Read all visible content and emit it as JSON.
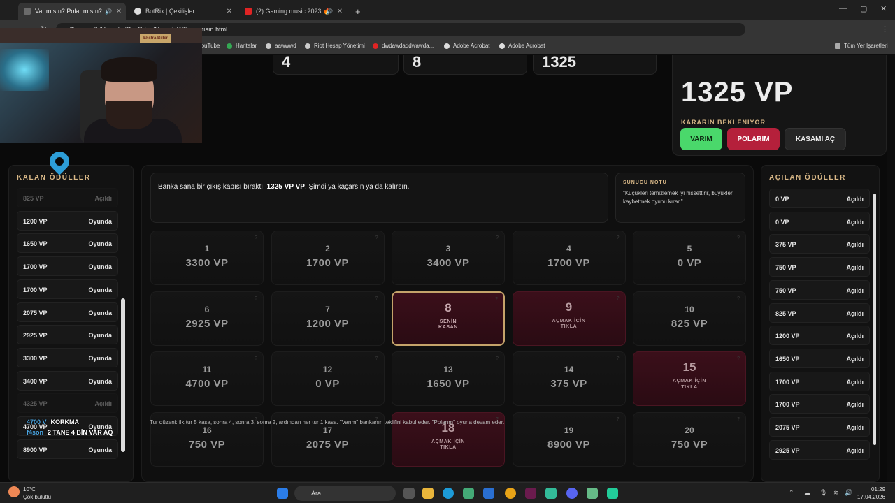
{
  "browser": {
    "tabs": [
      {
        "label": "Var mısın? Polar mısın?",
        "active": true
      },
      {
        "label": "BotRix | Çekilişler",
        "active": false
      },
      {
        "label": "(2) Gaming music 2023 🔥",
        "active": false
      }
    ],
    "new_tab": "+",
    "url_scheme": "Dosya",
    "url": "C:/Users/.../OneDrive/Masaüstü/Polarmısın.html",
    "bookmarks": [
      "YouTube",
      "Haritalar",
      "aawwwd",
      "Riot Hesap Yönetimi",
      "dwdawdaddwawda...",
      "Adobe Acrobat",
      "Adobe Acrobat"
    ],
    "all_bookmarks": "Tüm Yer İşaretleri"
  },
  "stats": [
    "4",
    "8",
    "1325"
  ],
  "offer": {
    "amount": "1325 VP",
    "status": "KARARIN BEKLENIYOR",
    "btn_varim": "VARIM",
    "btn_polarim": "POLARIM",
    "btn_kasa": "KASAMI AÇ"
  },
  "left_panel": {
    "title": "KALAN ÖDÜLLER",
    "rows": [
      {
        "value": "825 VP",
        "status": "Açıldı"
      },
      {
        "value": "1200 VP",
        "status": "Oyunda"
      },
      {
        "value": "1650 VP",
        "status": "Oyunda"
      },
      {
        "value": "1700 VP",
        "status": "Oyunda"
      },
      {
        "value": "1700 VP",
        "status": "Oyunda"
      },
      {
        "value": "2075 VP",
        "status": "Oyunda"
      },
      {
        "value": "2925 VP",
        "status": "Oyunda"
      },
      {
        "value": "3300 VP",
        "status": "Oyunda"
      },
      {
        "value": "3400 VP",
        "status": "Oyunda"
      },
      {
        "value": "4325 VP",
        "status": "Açıldı"
      },
      {
        "value": "4700 VP",
        "status": "Oyunda"
      },
      {
        "value": "8900 VP",
        "status": "Oyunda"
      }
    ]
  },
  "right_panel": {
    "title": "AÇILAN ÖDÜLLER",
    "rows": [
      {
        "value": "0 VP",
        "status": "Açıldı"
      },
      {
        "value": "0 VP",
        "status": "Açıldı"
      },
      {
        "value": "375 VP",
        "status": "Açıldı"
      },
      {
        "value": "750 VP",
        "status": "Açıldı"
      },
      {
        "value": "750 VP",
        "status": "Açıldı"
      },
      {
        "value": "825 VP",
        "status": "Açıldı"
      },
      {
        "value": "1200 VP",
        "status": "Açıldı"
      },
      {
        "value": "1650 VP",
        "status": "Açıldı"
      },
      {
        "value": "1700 VP",
        "status": "Açıldı"
      },
      {
        "value": "1700 VP",
        "status": "Açıldı"
      },
      {
        "value": "2075 VP",
        "status": "Açıldı"
      },
      {
        "value": "2925 VP",
        "status": "Açıldı"
      }
    ]
  },
  "message": {
    "prefix": "Banka sana bir çıkış kapısı bıraktı: ",
    "bold": "1325 VP VP",
    "suffix": ". Şimdi ya kaçarsın ya da kalırsın."
  },
  "host_note": {
    "title": "SUNUCU NOTU",
    "text": "\"Küçükleri temizlemek iyi hissettirir, büyükleri kaybetmek oyunu kırar.\""
  },
  "boxes": [
    {
      "n": "1",
      "p": "3300 VP",
      "state": "opened"
    },
    {
      "n": "2",
      "p": "1700 VP",
      "state": "opened"
    },
    {
      "n": "3",
      "p": "3400 VP",
      "state": "opened"
    },
    {
      "n": "4",
      "p": "1700 VP",
      "state": "opened"
    },
    {
      "n": "5",
      "p": "0 VP",
      "state": "opened"
    },
    {
      "n": "6",
      "p": "2925 VP",
      "state": "opened"
    },
    {
      "n": "7",
      "p": "1200 VP",
      "state": "opened"
    },
    {
      "n": "8",
      "p": "SENİN KASAN",
      "state": "mine"
    },
    {
      "n": "9",
      "p": "AÇMAK İÇİN TIKLA",
      "state": "closed"
    },
    {
      "n": "10",
      "p": "825 VP",
      "state": "opened"
    },
    {
      "n": "11",
      "p": "4700 VP",
      "state": "opened"
    },
    {
      "n": "12",
      "p": "0 VP",
      "state": "opened"
    },
    {
      "n": "13",
      "p": "1650 VP",
      "state": "opened"
    },
    {
      "n": "14",
      "p": "375 VP",
      "state": "opened"
    },
    {
      "n": "15",
      "p": "AÇMAK İÇİN TIKLA",
      "state": "closed"
    },
    {
      "n": "16",
      "p": "750 VP",
      "state": "opened"
    },
    {
      "n": "17",
      "p": "2075 VP",
      "state": "opened"
    },
    {
      "n": "18",
      "p": "AÇMAK İÇİN TIKLA",
      "state": "closed"
    },
    {
      "n": "19",
      "p": "8900 VP",
      "state": "opened"
    },
    {
      "n": "20",
      "p": "750 VP",
      "state": "opened"
    }
  ],
  "rules": "Tur düzeni: ilk tur 5 kasa, sonra 4, sonra 3, sonra 2, ardından her tur 1 kasa. \"Varım\" bankanın teklifini kabul eder. \"Polarım\" oyuna devam eder.",
  "webcam_sign": "Ekstra Biller",
  "chat": [
    {
      "user": "4700 V",
      "text": "KORKMA"
    },
    {
      "user": "f4son",
      "text": "2 TANE 4 BİN VAR AQ"
    }
  ],
  "taskbar": {
    "weather_temp": "10°C",
    "weather_desc": "Çok bulutlu",
    "search": "Ara",
    "time": "01:29",
    "date": "17.04.2026"
  },
  "colors": {
    "accent_gold": "#d9b887",
    "green": "#4ad86b",
    "red": "#b5203b",
    "box_red": "#3b0f1a"
  }
}
